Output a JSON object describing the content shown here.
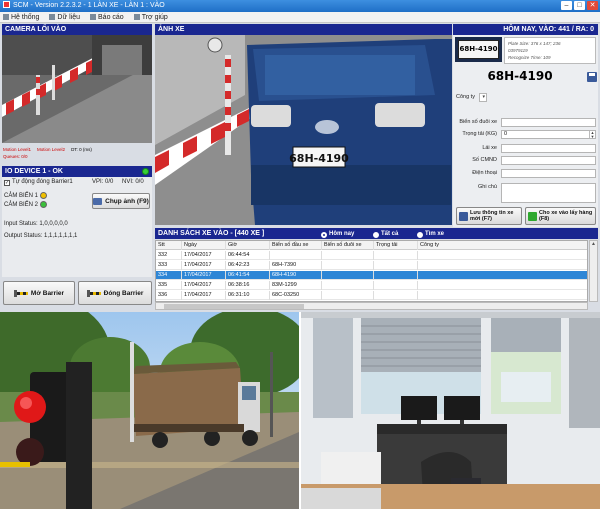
{
  "window": {
    "title": "SCM - Version 2.2.3.2 - 1 LÀN XE - LÀN 1 : VÀO",
    "minimize": "–",
    "maximize": "□",
    "close": "✕"
  },
  "menu": [
    "Hệ thống",
    "Dữ liệu",
    "Báo cáo",
    "Trợ giúp"
  ],
  "camera": {
    "header": "CAMERA LỐI VÀO",
    "motion1": "Motion Level1",
    "motion2": "Motion Level2",
    "dt": "DT: 0 (ms)",
    "queue": "Queues: 0/0"
  },
  "io": {
    "header": "IO DEVICE 1 - OK",
    "auto_close": "Tự động đóng Barrier1",
    "vpi": "VPI: 0/0",
    "nvi": "NVI: 0/0",
    "sensor1": "CẢM BIẾN 1",
    "sensor2": "CẢM BIẾN 2",
    "capture_btn": "Chụp ảnh (F9)",
    "input_status": "Input Status: 1,0,0,0,0,0",
    "output_status": "Output Status: 1,1,1,1,1,1,1",
    "open_btn": "Mở Barrier",
    "close_btn": "Đóng Barrier",
    "colors": {
      "sensor_on": "#f0c000",
      "sensor_ok": "#3ac03a"
    }
  },
  "image_panel": {
    "header": "ẢNH XE",
    "plate_text": "68H-4190"
  },
  "status_header": "HÔM NAY, VÀO: 441 / RA: 0",
  "plate_info": {
    "thumb_plate": "68H-4190",
    "plate_size": "Plate Size: 376 x 147; 236",
    "code": "03979119",
    "recognize_time": "Recognize Time: 109",
    "plate_big": "68H-4190"
  },
  "form": {
    "company_label": "Công ty",
    "tail_plate_label": "Biển số đuôi xe",
    "load_label": "Trọng tải (KG)",
    "load_value": "0",
    "driver_label": "Lái xe",
    "id_label": "Số CMND",
    "phone_label": "Điện thoại",
    "note_label": "Ghi chú",
    "save_btn": "Lưu thông tin xe mới (F7)",
    "enter_btn": "Cho xe vào lấy hàng (F8)"
  },
  "list": {
    "header": "DANH SÁCH XE VÀO - [440 XE ]",
    "filters": {
      "today": "Hôm nay",
      "all": "Tất cả",
      "search": "Tìm xe"
    },
    "columns": [
      "Stt",
      "Ngày",
      "Giờ",
      "Biển số đầu xe",
      "Biển số đuôi xe",
      "Trọng tải",
      "Công ty"
    ],
    "rows": [
      [
        "332",
        "17/04/2017",
        "06:44:54",
        "",
        "",
        "",
        ""
      ],
      [
        "333",
        "17/04/2017",
        "06:42:23",
        "68H-7390",
        "",
        "",
        ""
      ],
      [
        "334",
        "17/04/2017",
        "06:41:54",
        "68H-4190",
        "",
        "",
        ""
      ],
      [
        "335",
        "17/04/2017",
        "06:38:16",
        "83M-1299",
        "",
        "",
        ""
      ],
      [
        "336",
        "17/04/2017",
        "06:31:10",
        "68C-03250",
        "",
        "",
        ""
      ]
    ],
    "selected_index": 2
  }
}
